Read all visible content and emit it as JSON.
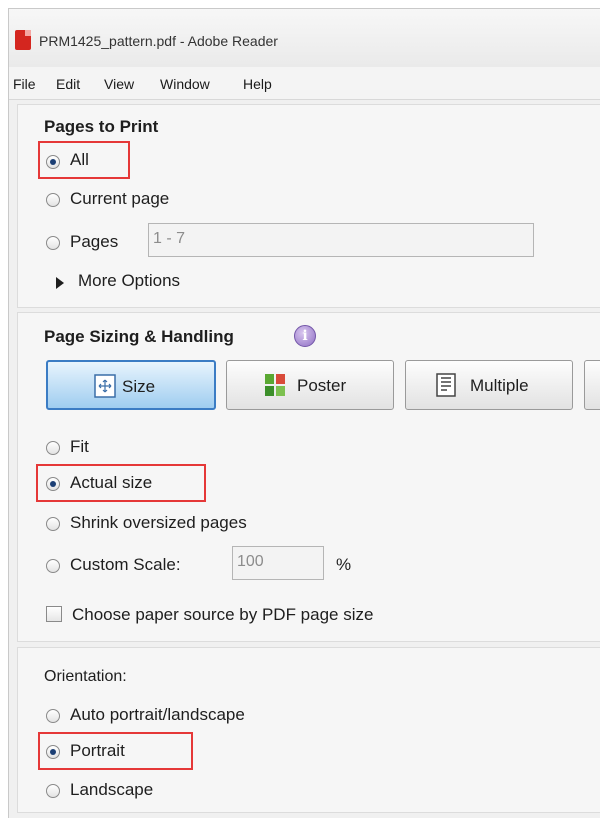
{
  "window": {
    "title": "PRM1425_pattern.pdf - Adobe Reader"
  },
  "menu": [
    "File",
    "Edit",
    "View",
    "Window",
    "Help"
  ],
  "pages_to_print": {
    "title": "Pages to Print",
    "options": {
      "all": "All",
      "current": "Current page",
      "pages": "Pages"
    },
    "selected": "All",
    "pages_value": "1 - 7",
    "more_options": "More Options"
  },
  "page_sizing": {
    "title": "Page Sizing & Handling",
    "info_icon": "info-icon",
    "buttons": {
      "size": "Size",
      "poster": "Poster",
      "multiple": "Multiple"
    },
    "active_button": "Size",
    "options": {
      "fit": "Fit",
      "actual": "Actual size",
      "shrink": "Shrink oversized pages",
      "custom": "Custom Scale:"
    },
    "selected": "Actual size",
    "custom_scale_value": "100",
    "percent": "%",
    "paper_source": "Choose paper source by PDF page size",
    "paper_source_checked": false
  },
  "orientation": {
    "title": "Orientation:",
    "options": {
      "auto": "Auto portrait/landscape",
      "portrait": "Portrait",
      "landscape": "Landscape"
    },
    "selected": "Portrait"
  },
  "colors": {
    "highlight": "#e53838",
    "active_button": "#9fcdf0",
    "pdf_icon": "#d4261f"
  }
}
